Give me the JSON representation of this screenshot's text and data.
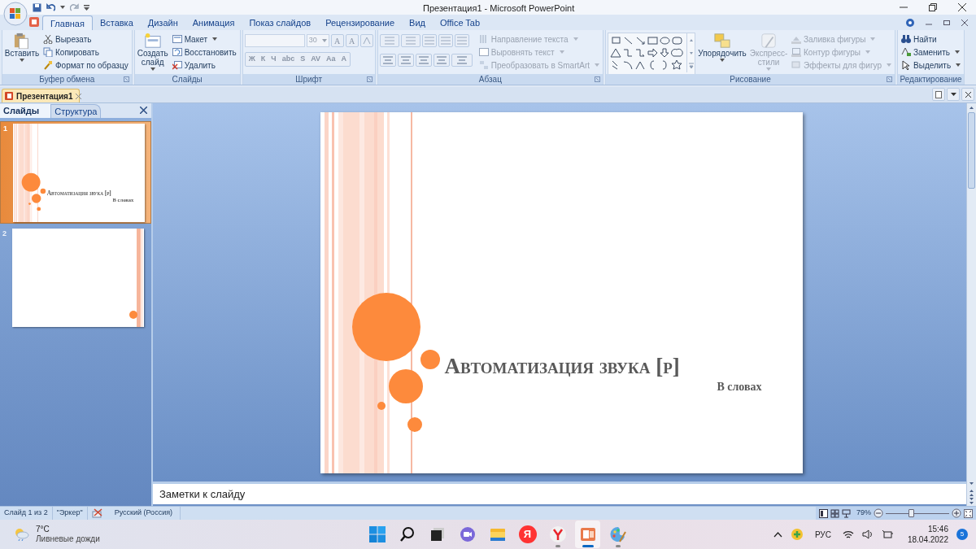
{
  "window": {
    "title": "Презентация1 - Microsoft PowerPoint"
  },
  "ribbon_tabs": [
    {
      "label": "Главная",
      "selected": true
    },
    {
      "label": "Вставка",
      "selected": false
    },
    {
      "label": "Дизайн",
      "selected": false
    },
    {
      "label": "Анимация",
      "selected": false
    },
    {
      "label": "Показ слайдов",
      "selected": false
    },
    {
      "label": "Рецензирование",
      "selected": false
    },
    {
      "label": "Вид",
      "selected": false
    },
    {
      "label": "Office Tab",
      "selected": false
    }
  ],
  "ribbon_groups": [
    {
      "kind": "clipboard",
      "label": "Буфер обмена",
      "items": [
        {
          "label": "Вставить",
          "disabled": false,
          "dropdown": true
        },
        {
          "label": "Вырезать",
          "disabled": false,
          "dropdown": false
        },
        {
          "label": "Копировать",
          "disabled": false,
          "dropdown": false
        },
        {
          "label": "Формат по образцу",
          "disabled": false,
          "dropdown": false
        }
      ]
    },
    {
      "kind": "slides",
      "label": "Слайды",
      "items": [
        {
          "label": "Создать слайд",
          "disabled": false,
          "dropdown": true
        },
        {
          "label": "Макет",
          "disabled": false,
          "dropdown": true
        },
        {
          "label": "Восстановить",
          "disabled": false,
          "dropdown": false
        },
        {
          "label": "Удалить",
          "disabled": false,
          "dropdown": false
        }
      ]
    },
    {
      "kind": "font",
      "label": "Шрифт",
      "font_size": "30",
      "row1_buttons": [
        "A",
        "A"
      ],
      "row2_buttons": [
        "Ж",
        "К",
        "Ч",
        "abc",
        "S",
        "AV",
        "Aa",
        "A"
      ]
    },
    {
      "kind": "paragraph",
      "label": "Абзац",
      "items": [
        {
          "label": "Направление текста",
          "disabled": true,
          "dropdown": true
        },
        {
          "label": "Выровнять текст",
          "disabled": true,
          "dropdown": true
        },
        {
          "label": "Преобразовать в SmartArt",
          "disabled": true,
          "dropdown": true
        }
      ]
    },
    {
      "kind": "drawing",
      "label": "Рисование",
      "items": [
        {
          "label": "Упорядочить",
          "disabled": false,
          "dropdown": true
        },
        {
          "label": "Экспресс-стили",
          "disabled": true,
          "dropdown": true
        },
        {
          "label": "Заливка фигуры",
          "disabled": true,
          "dropdown": true
        },
        {
          "label": "Контур фигуры",
          "disabled": true,
          "dropdown": true
        },
        {
          "label": "Эффекты для фигур",
          "disabled": true,
          "dropdown": true
        }
      ]
    },
    {
      "kind": "editing",
      "label": "Редактирование",
      "items": [
        {
          "label": "Найти",
          "disabled": false,
          "dropdown": false
        },
        {
          "label": "Заменить",
          "disabled": false,
          "dropdown": true
        },
        {
          "label": "Выделить",
          "disabled": false,
          "dropdown": true
        }
      ]
    }
  ],
  "document_tab": {
    "label": "Презентация1"
  },
  "pane_tabs": [
    {
      "label": "Слайды",
      "selected": true
    },
    {
      "label": "Структура",
      "selected": false
    }
  ],
  "thumbnails": [
    {
      "number": "1",
      "selected": true,
      "kind": "title",
      "title": "Автоматизация звука [р]",
      "subtitle": "В словах"
    },
    {
      "number": "2",
      "selected": false,
      "kind": "blank"
    }
  ],
  "slide": {
    "title": "Автоматизация звука [р]",
    "subtitle": "В словах"
  },
  "notes": {
    "placeholder": "Заметки к слайду"
  },
  "status_bar": {
    "items": [
      "Слайд 1 из 2",
      "\"Эркер\"",
      "Русский (Россия)"
    ],
    "zoom": "79%",
    "zoom_slider": {
      "level": 0.4
    }
  },
  "taskbar": {
    "weather": {
      "temperature": "7°C",
      "condition": "Ливневые дожди"
    },
    "apps": [
      {
        "kind": "start",
        "running": false,
        "active": false
      },
      {
        "kind": "search",
        "running": false,
        "active": false
      },
      {
        "kind": "taskview",
        "running": false,
        "active": false
      },
      {
        "kind": "chat",
        "running": false,
        "active": false
      },
      {
        "kind": "explorer",
        "running": false,
        "active": false
      },
      {
        "kind": "yandex",
        "label": "Я",
        "running": false,
        "active": false
      },
      {
        "kind": "browser",
        "running": true,
        "active": false
      },
      {
        "kind": "powerpoint",
        "running": true,
        "active": true
      },
      {
        "kind": "paint",
        "running": true,
        "active": false
      }
    ],
    "language": "РУС",
    "time": "15:46",
    "date": "18.04.2022",
    "notifications": "5"
  }
}
